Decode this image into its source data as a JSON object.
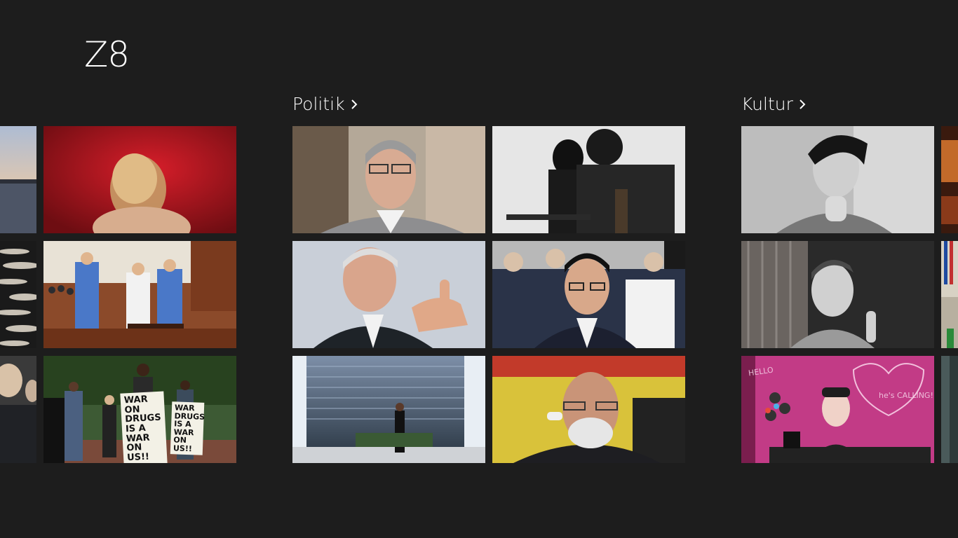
{
  "app": {
    "title": "Z8"
  },
  "sections": {
    "politik": {
      "label": "Politik"
    },
    "kultur": {
      "label": "Kultur"
    }
  },
  "tiles": {
    "protest_sign_1": "WAR ON DRUGS IS A WAR ON US!!",
    "protest_sign_2": "WAR DRUGS IS A WAR ON US!!",
    "chalkboard_text": "HELLO",
    "chalkboard_text_2": "he's CALLING!"
  },
  "icons": {
    "section_chevron": "chevron-right-icon"
  },
  "colors": {
    "background": "#1d1d1d",
    "text": "#ffffff"
  }
}
